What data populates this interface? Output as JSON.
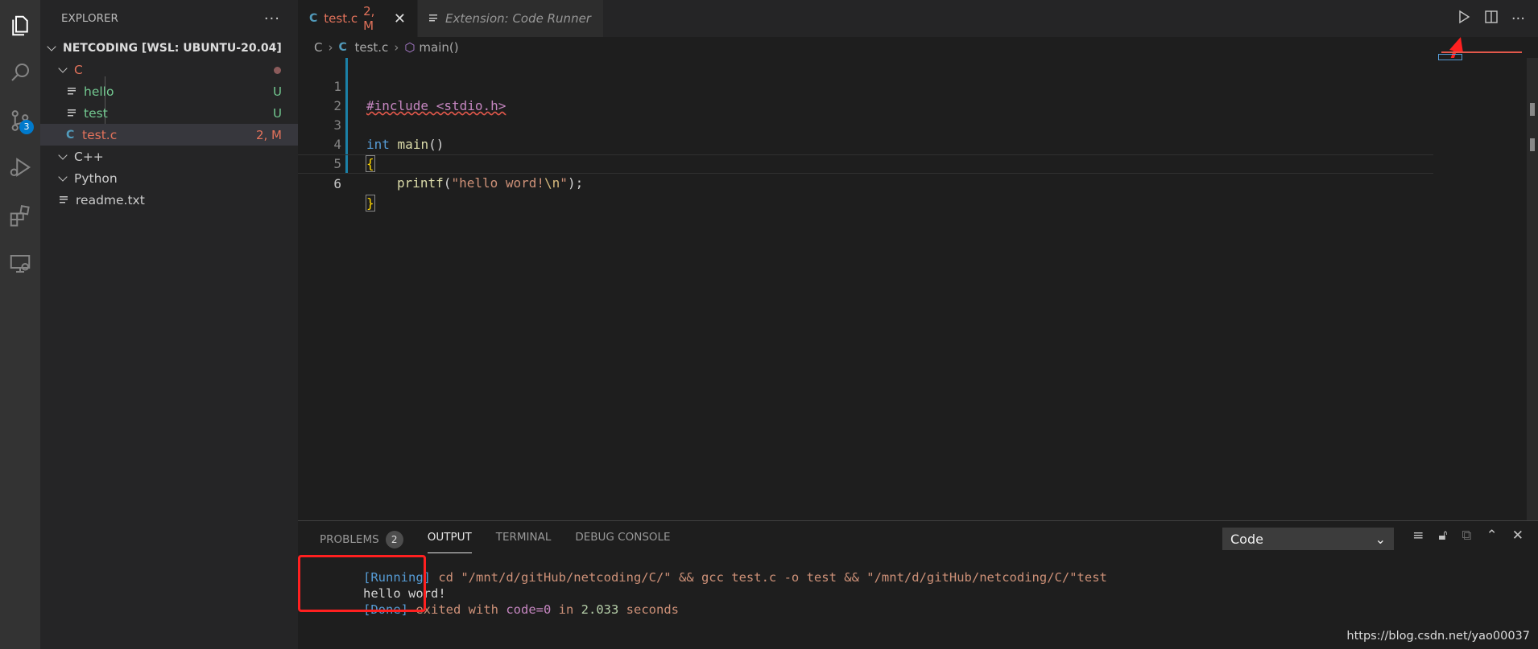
{
  "activity_bar": {
    "scm_badge": "3"
  },
  "explorer": {
    "title": "EXPLORER",
    "workspace": "NETCODING [WSL: UBUNTU-20.04]",
    "items": [
      {
        "label": "C",
        "decoration": ""
      },
      {
        "label": "hello",
        "decoration": "U"
      },
      {
        "label": "test",
        "decoration": "U"
      },
      {
        "label": "test.c",
        "decoration": "2, M"
      },
      {
        "label": "C++"
      },
      {
        "label": "Python"
      },
      {
        "label": "readme.txt"
      }
    ]
  },
  "tabs": [
    {
      "label": "test.c",
      "status": "2, M"
    },
    {
      "label": "Extension: Code Runner"
    }
  ],
  "breadcrumb": {
    "folder": "C",
    "file": "test.c",
    "symbol": "main()"
  },
  "editor": {
    "lines": [
      {
        "n": "1",
        "include": "#include <stdio.h>"
      },
      {
        "n": "2"
      },
      {
        "n": "3",
        "kw": "int",
        "fn": "main",
        "rest": "()"
      },
      {
        "n": "4",
        "brace": "{"
      },
      {
        "n": "5",
        "fn": "printf",
        "str1": "\"hello word!",
        "esc": "\\n",
        "str2": "\"",
        "rest": ");"
      },
      {
        "n": "6",
        "brace": "}"
      }
    ]
  },
  "panel": {
    "tabs": {
      "problems": "PROBLEMS",
      "problems_count": "2",
      "output": "OUTPUT",
      "terminal": "TERMINAL",
      "debug": "DEBUG CONSOLE"
    },
    "channel": "Code",
    "output": {
      "running_tag": "[Running]",
      "running_cmd": " cd \"/mnt/d/gitHub/netcoding/C/\" && gcc test.c -o test && \"/mnt/d/gitHub/netcoding/C/\"test",
      "program_out": "hello word!",
      "done_tag": "[Done]",
      "done_1": " exited ",
      "done_2": "with ",
      "done_code": "code=0",
      "done_3": " in ",
      "done_secs": "2.033",
      "done_4": " seconds"
    }
  },
  "watermark": "https://blog.csdn.net/yao00037",
  "colors": {
    "accent": "#007acc",
    "annotation": "#ff2020"
  }
}
